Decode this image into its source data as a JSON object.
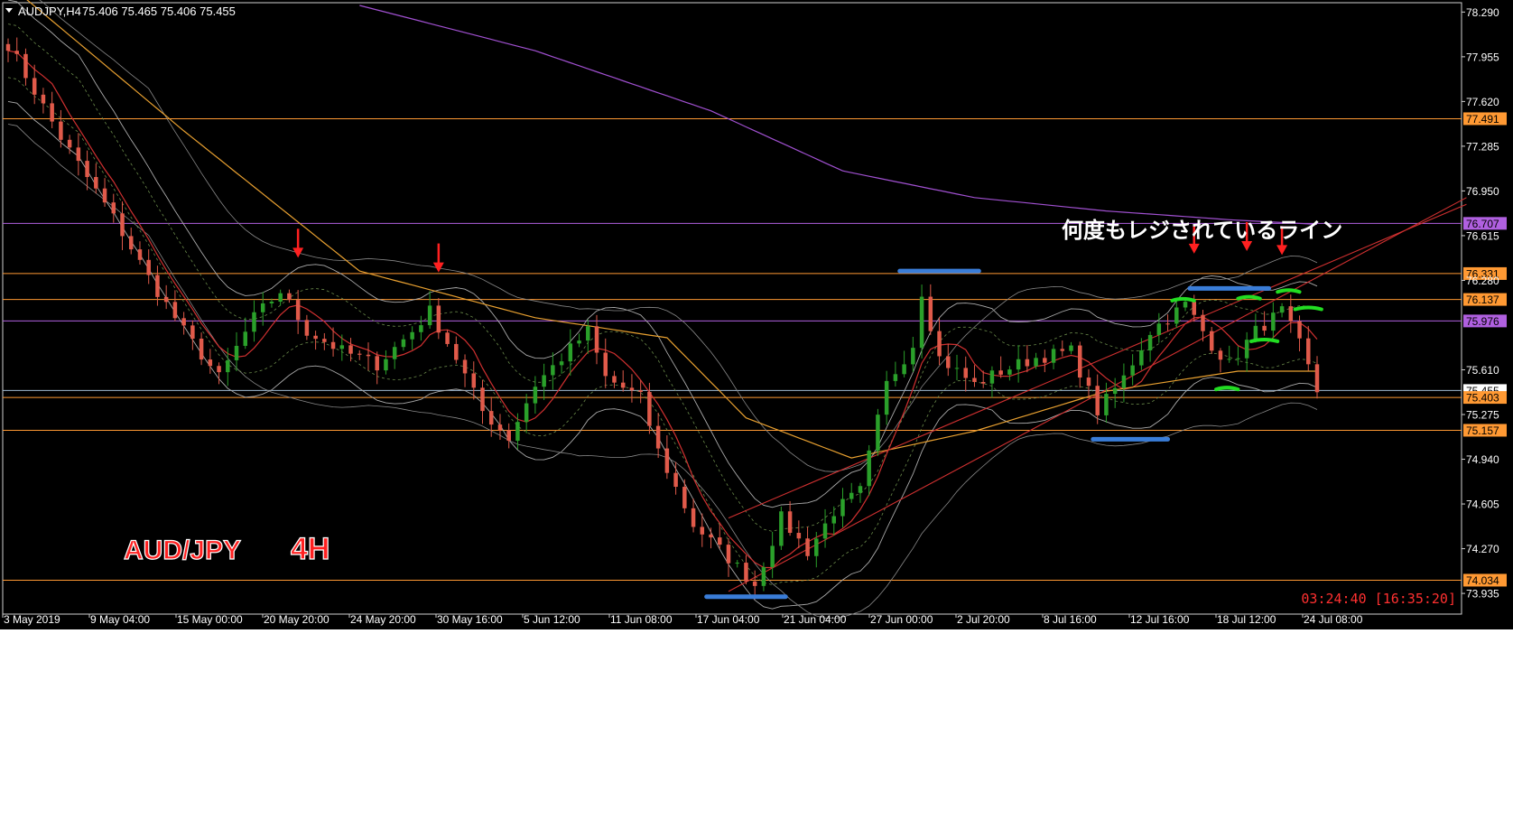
{
  "header": {
    "symbol_timeframe": "AUDJPY,H4",
    "ohlc": "75.406 75.465 75.406 75.455",
    "dropdown_icon": "triangle-down-icon"
  },
  "annotations": {
    "main_note": "何度もレジされているライン",
    "pair_label": "AUD/JPY",
    "timeframe_label": "4H"
  },
  "status": {
    "timer": "03:24:40 [16:35:20]"
  },
  "colors": {
    "background": "#000000",
    "bull": "#2aa02a",
    "bear": "#e05a4a",
    "horizontal_orange": "#ff9933",
    "horizontal_purple": "#b060e0",
    "trend_red": "#d03030",
    "sma_orange": "#e8a030",
    "sma_purple": "#a050d0",
    "price_tag": "#ffffff",
    "annotation_red": "#ff2020",
    "mark_blue": "#3a7dd8",
    "mark_green": "#22dd22"
  },
  "chart_data": {
    "type": "candlestick",
    "symbol": "AUDJPY",
    "timeframe": "H4",
    "y_range": [
      73.78,
      78.36
    ],
    "price_ticks": [
      "78.290",
      "77.955",
      "77.620",
      "77.285",
      "76.950",
      "76.615",
      "76.280",
      "75.610",
      "75.275",
      "74.940",
      "74.605",
      "74.270",
      "73.935"
    ],
    "time_labels": [
      "3 May 2019",
      "9 May 04:00",
      "15 May 00:00",
      "20 May 20:00",
      "24 May 20:00",
      "30 May 16:00",
      "5 Jun 12:00",
      "11 Jun 08:00",
      "17 Jun 04:00",
      "21 Jun 04:00",
      "27 Jun 00:00",
      "2 Jul 20:00",
      "8 Jul 16:00",
      "12 Jul 16:00",
      "18 Jul 12:00",
      "24 Jul 08:00"
    ],
    "horizontal_levels": [
      {
        "price": 77.491,
        "label": "77.491",
        "color": "orange"
      },
      {
        "price": 76.707,
        "label": "76.707",
        "color": "purple"
      },
      {
        "price": 76.331,
        "label": "76.331",
        "color": "orange"
      },
      {
        "price": 76.137,
        "label": "76.137",
        "color": "orange"
      },
      {
        "price": 75.976,
        "label": "75.976",
        "color": "purple"
      },
      {
        "price": 75.455,
        "label": "75.455",
        "color": "white"
      },
      {
        "price": 75.403,
        "label": "75.403",
        "color": "orange"
      },
      {
        "price": 75.157,
        "label": "75.157",
        "color": "orange"
      },
      {
        "price": 74.034,
        "label": "74.034",
        "color": "orange"
      }
    ],
    "close_path": [
      [
        0,
        78.05
      ],
      [
        6,
        77.35
      ],
      [
        12,
        76.75
      ],
      [
        16,
        76.3
      ],
      [
        20,
        75.9
      ],
      [
        24,
        75.55
      ],
      [
        28,
        76.0
      ],
      [
        31,
        76.2
      ],
      [
        34,
        75.9
      ],
      [
        38,
        75.75
      ],
      [
        42,
        75.65
      ],
      [
        46,
        75.9
      ],
      [
        48,
        76.05
      ],
      [
        51,
        75.7
      ],
      [
        54,
        75.3
      ],
      [
        57,
        75.1
      ],
      [
        60,
        75.5
      ],
      [
        63,
        75.7
      ],
      [
        66,
        75.9
      ],
      [
        68,
        75.55
      ],
      [
        72,
        75.4
      ],
      [
        74,
        75.0
      ],
      [
        78,
        74.45
      ],
      [
        82,
        74.2
      ],
      [
        85,
        74.0
      ],
      [
        88,
        74.5
      ],
      [
        91,
        74.25
      ],
      [
        94,
        74.55
      ],
      [
        97,
        74.7
      ],
      [
        100,
        75.5
      ],
      [
        103,
        75.8
      ],
      [
        104,
        76.2
      ],
      [
        106,
        75.7
      ],
      [
        110,
        75.5
      ],
      [
        113,
        75.6
      ],
      [
        117,
        75.7
      ],
      [
        121,
        75.75
      ],
      [
        124,
        75.3
      ],
      [
        127,
        75.55
      ],
      [
        130,
        75.9
      ],
      [
        134,
        76.1
      ],
      [
        137,
        75.8
      ],
      [
        139,
        75.65
      ],
      [
        142,
        75.9
      ],
      [
        145,
        76.05
      ],
      [
        147,
        75.8
      ],
      [
        149,
        75.45
      ]
    ],
    "sma_orange_path": [
      [
        0,
        78.5
      ],
      [
        20,
        77.4
      ],
      [
        40,
        76.35
      ],
      [
        60,
        76.0
      ],
      [
        75,
        75.85
      ],
      [
        84,
        75.25
      ],
      [
        96,
        74.95
      ],
      [
        110,
        75.15
      ],
      [
        125,
        75.45
      ],
      [
        140,
        75.6
      ],
      [
        149,
        75.6
      ]
    ],
    "sma_purple_path": [
      [
        40,
        78.34
      ],
      [
        60,
        78.0
      ],
      [
        80,
        77.55
      ],
      [
        95,
        77.1
      ],
      [
        110,
        76.9
      ],
      [
        125,
        76.8
      ],
      [
        140,
        76.73
      ],
      [
        149,
        76.7
      ]
    ],
    "trendlines": [
      {
        "from": [
          82,
          73.95
        ],
        "to": [
          166,
          76.9
        ]
      },
      {
        "from": [
          82,
          74.5
        ],
        "to": [
          166,
          76.85
        ]
      }
    ],
    "down_arrows": [
      [
        33,
        76.45
      ],
      [
        49,
        76.34
      ],
      [
        135,
        76.48
      ],
      [
        141,
        76.5
      ],
      [
        145,
        76.47
      ]
    ],
    "blue_marks": [
      {
        "x0": 79.5,
        "x1": 88.5,
        "price": 73.91
      },
      {
        "x0": 101.5,
        "x1": 110.5,
        "price": 76.35
      },
      {
        "x0": 123.5,
        "x1": 132,
        "price": 75.09
      },
      {
        "x0": 134.5,
        "x1": 143.5,
        "price": 76.22
      }
    ],
    "green_marks": [
      {
        "x0": 132.5,
        "x1": 135,
        "price": 76.135
      },
      {
        "x0": 140,
        "x1": 142.5,
        "price": 76.15
      },
      {
        "x0": 144.5,
        "x1": 147,
        "price": 76.2
      },
      {
        "x0": 146.5,
        "x1": 149.5,
        "price": 76.07
      },
      {
        "x0": 141.5,
        "x1": 144.5,
        "price": 75.83
      },
      {
        "x0": 137.5,
        "x1": 140,
        "price": 75.47
      }
    ]
  }
}
